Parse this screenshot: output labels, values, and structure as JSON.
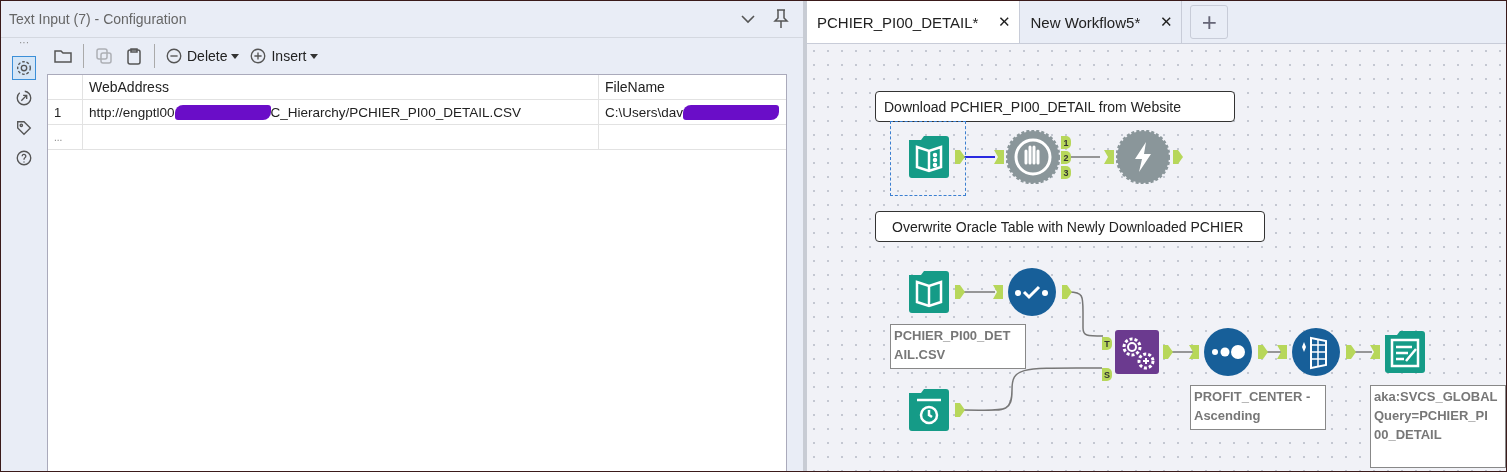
{
  "config_panel": {
    "title": "Text Input (7) - Configuration",
    "more": "···",
    "side_icons": [
      {
        "kind": "gear",
        "selected": true
      },
      {
        "kind": "arrow",
        "selected": false
      },
      {
        "kind": "tag",
        "selected": false
      },
      {
        "kind": "help",
        "selected": false
      }
    ],
    "toolbar": [
      {
        "kind": "folder",
        "disabled": false
      },
      {
        "kind": "copy",
        "disabled": true
      },
      {
        "kind": "paste",
        "disabled": false
      },
      {
        "kind": "delete",
        "label": "Delete",
        "disabled": false
      },
      {
        "kind": "insert",
        "label": "Insert",
        "disabled": false
      }
    ],
    "table": {
      "columns": [
        "WebAddress",
        "FileName"
      ],
      "rows": [
        {
          "number": "1",
          "cells": [
            {
              "before": "http://engptl00",
              "after": "C_Hierarchy/PCHIER_PI00_DETAIL.CSV",
              "redacted": true
            },
            {
              "before": "C:\\Users\\dav",
              "redacted": true
            }
          ]
        }
      ],
      "new_row_marker": "..."
    }
  },
  "workflow": {
    "tabs": [
      {
        "label": "PCHIER_PI00_DETAIL*",
        "selected": true,
        "close": "✕"
      },
      {
        "label": "New Workflow5*",
        "selected": false,
        "close": "✕"
      }
    ],
    "add_tab": "+",
    "comments": [
      "Download PCHIER_PI00_DETAIL from Website",
      "Overwrite Oracle Table with Newly Downloaded PCHIER"
    ],
    "tools": [
      {
        "kind": "download_input",
        "selected": true
      },
      {
        "kind": "block",
        "anchors": [
          "1",
          "2",
          "3"
        ]
      },
      {
        "kind": "bolt"
      },
      {
        "kind": "book_input",
        "label": "PCHIER_PI00_DET\nAIL.CSV"
      },
      {
        "kind": "check"
      },
      {
        "kind": "clock_input"
      },
      {
        "kind": "gears",
        "anchors": [
          "T",
          "S"
        ]
      },
      {
        "kind": "sort",
        "label": "PROFIT_CENTER -\nAscending"
      },
      {
        "kind": "formula"
      },
      {
        "kind": "output",
        "label": "aka:SVCS_GLOBAL\nQuery=PCHIER_PI\n00_DETAIL"
      }
    ]
  }
}
